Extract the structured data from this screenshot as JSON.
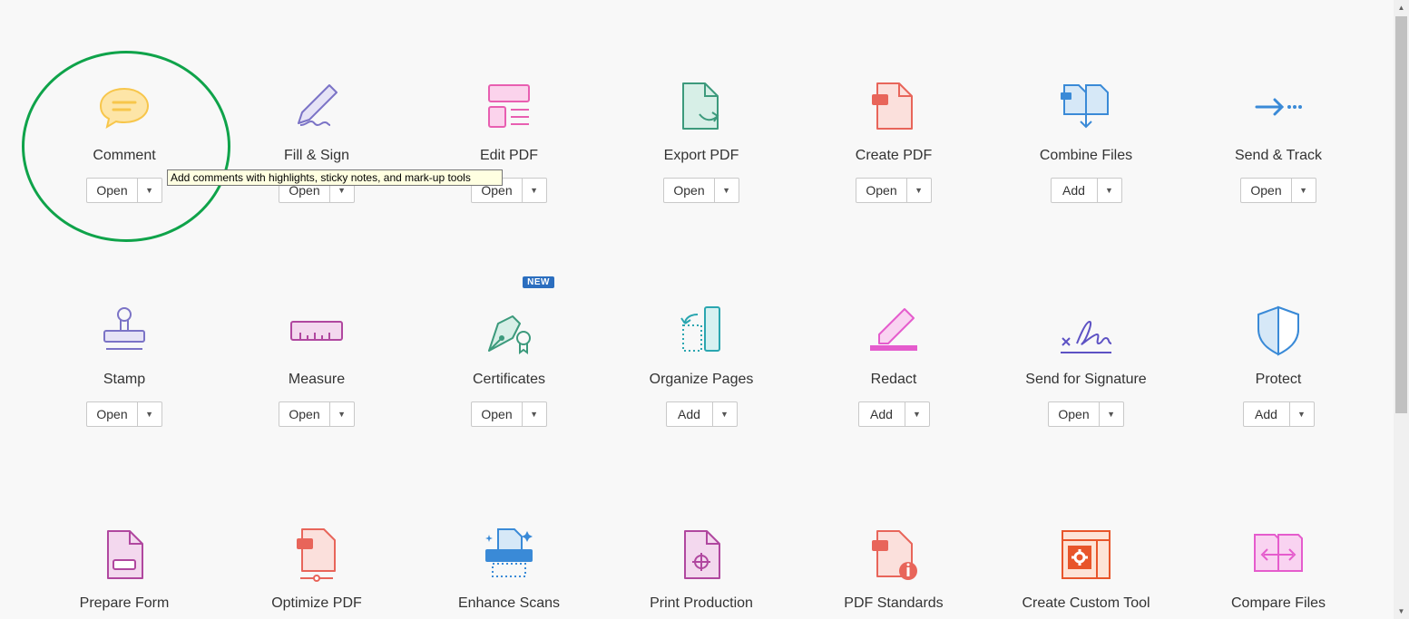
{
  "tools": [
    {
      "label": "Comment",
      "button": "Open",
      "icon": "comment-icon"
    },
    {
      "label": "Fill & Sign",
      "button": "Open",
      "icon": "fill-sign-icon"
    },
    {
      "label": "Edit PDF",
      "button": "Open",
      "icon": "edit-pdf-icon"
    },
    {
      "label": "Export PDF",
      "button": "Open",
      "icon": "export-pdf-icon"
    },
    {
      "label": "Create PDF",
      "button": "Open",
      "icon": "create-pdf-icon"
    },
    {
      "label": "Combine Files",
      "button": "Add",
      "icon": "combine-files-icon"
    },
    {
      "label": "Send & Track",
      "button": "Open",
      "icon": "send-track-icon"
    },
    {
      "label": "Stamp",
      "button": "Open",
      "icon": "stamp-icon"
    },
    {
      "label": "Measure",
      "button": "Open",
      "icon": "measure-icon"
    },
    {
      "label": "Certificates",
      "button": "Open",
      "icon": "certificates-icon",
      "badge": "NEW"
    },
    {
      "label": "Organize Pages",
      "button": "Add",
      "icon": "organize-pages-icon"
    },
    {
      "label": "Redact",
      "button": "Add",
      "icon": "redact-icon"
    },
    {
      "label": "Send for Signature",
      "button": "Open",
      "icon": "send-signature-icon"
    },
    {
      "label": "Protect",
      "button": "Add",
      "icon": "protect-icon"
    },
    {
      "label": "Prepare Form",
      "icon": "prepare-form-icon"
    },
    {
      "label": "Optimize PDF",
      "icon": "optimize-pdf-icon"
    },
    {
      "label": "Enhance Scans",
      "icon": "enhance-scans-icon"
    },
    {
      "label": "Print Production",
      "icon": "print-production-icon"
    },
    {
      "label": "PDF Standards",
      "icon": "pdf-standards-icon"
    },
    {
      "label": "Create Custom Tool",
      "icon": "create-custom-tool-icon"
    },
    {
      "label": "Compare Files",
      "icon": "compare-files-icon"
    }
  ],
  "tooltip": "Add comments with highlights, sticky notes, and mark-up tools",
  "colors": {
    "highlight": "#0fa34a",
    "tooltip_bg": "#ffffe1",
    "badge": "#2b6ebf"
  }
}
